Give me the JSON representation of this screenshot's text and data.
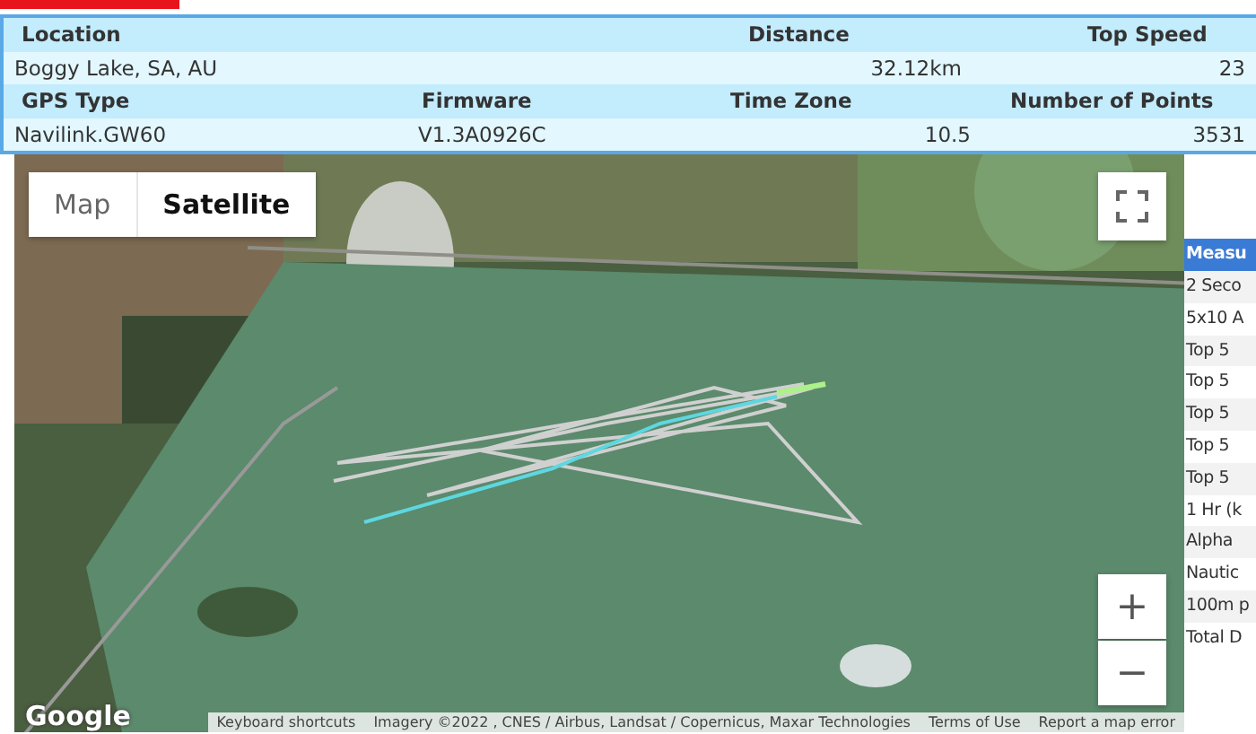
{
  "summary_table": [
    {
      "columns": [
        "Location",
        "Distance",
        "Top Speed"
      ],
      "values": [
        "Boggy Lake, SA, AU",
        "32.12km",
        "23"
      ]
    },
    {
      "columns": [
        "GPS Type",
        "Firmware",
        "Time Zone",
        "Number of Points"
      ],
      "values": [
        "Navilink.GW60",
        "V1.3A0926C",
        "10.5",
        "3531"
      ]
    }
  ],
  "map": {
    "type_buttons": [
      {
        "label": "Map",
        "selected": false
      },
      {
        "label": "Satellite",
        "selected": true
      }
    ],
    "zoom_in": "+",
    "zoom_out": "−",
    "logo": "Google",
    "attribution": [
      "Keyboard shortcuts",
      "Imagery ©2022 , CNES / Airbus, Landsat / Copernicus, Maxar Technologies",
      "Terms of Use",
      "Report a map error"
    ]
  },
  "measures": {
    "header": "Measu",
    "rows": [
      "2 Seco",
      "5x10 A",
      "Top 5",
      "Top 5",
      "Top 5",
      "Top 5",
      "Top 5",
      "1 Hr (k",
      "Alpha",
      "Nautic",
      "100m p",
      "Total D"
    ]
  }
}
